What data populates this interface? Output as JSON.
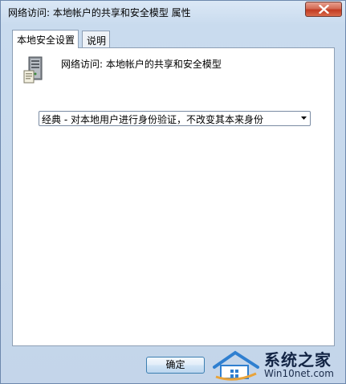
{
  "window": {
    "title": "网络访问: 本地帐户的共享和安全模型 属性"
  },
  "titlebar": {
    "close_icon": "close-icon",
    "close_color": "#c23b22"
  },
  "tabs": [
    {
      "label": "本地安全设置",
      "active": true
    },
    {
      "label": "说明",
      "active": false
    }
  ],
  "policy": {
    "icon": "server-computer-icon",
    "title": "网络访问: 本地帐户的共享和安全模型"
  },
  "dropdown": {
    "selected": "经典 - 对本地用户进行身份验证，不改变其本来身份",
    "arrow_icon": "chevron-down-icon"
  },
  "buttons": {
    "ok_label": "确定"
  },
  "watermark": {
    "brand": "系统之家",
    "site": "Win10net.com"
  }
}
